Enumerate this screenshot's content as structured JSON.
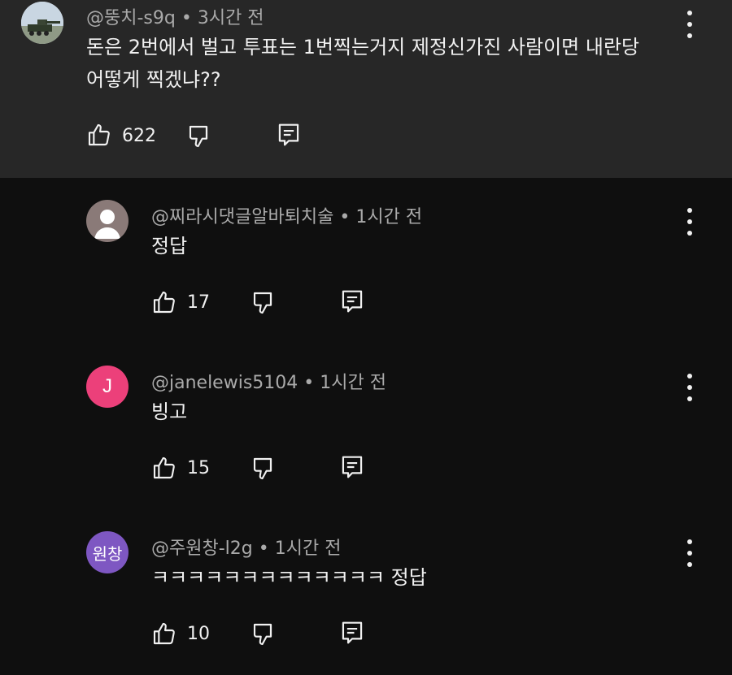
{
  "comments": [
    {
      "author": "@뚱치-s9q",
      "time": "3시간 전",
      "lines": [
        "돈은 2번에서 벌고 투표는 1번찍는거지 제정신가진 사람이면 내란당",
        "어떻게 찍겠냐??"
      ],
      "likes": "622",
      "avatar_icon": "cannon-photo-avatar"
    },
    {
      "author": "@찌라시댓글알바퇴치술",
      "time": "1시간 전",
      "lines": [
        "정답"
      ],
      "likes": "17",
      "avatar_icon": "default-person-avatar"
    },
    {
      "author": "@janelewis5104",
      "time": "1시간 전",
      "lines": [
        "빙고"
      ],
      "likes": "15",
      "avatar_letter": "J",
      "avatar_color": "#ec407a"
    },
    {
      "author": "@주원창-l2g",
      "time": "1시간 전",
      "lines": [
        "ㅋㅋㅋㅋㅋㅋㅋㅋㅋㅋㅋㅋㅋ 정답"
      ],
      "likes": "10",
      "avatar_letter": "원창",
      "avatar_color": "#7e57c2"
    }
  ],
  "separator": "•",
  "icons": {
    "like": "thumbs-up-icon",
    "dislike": "thumbs-down-icon",
    "reply": "reply-icon",
    "menu": "more-vertical-icon"
  }
}
